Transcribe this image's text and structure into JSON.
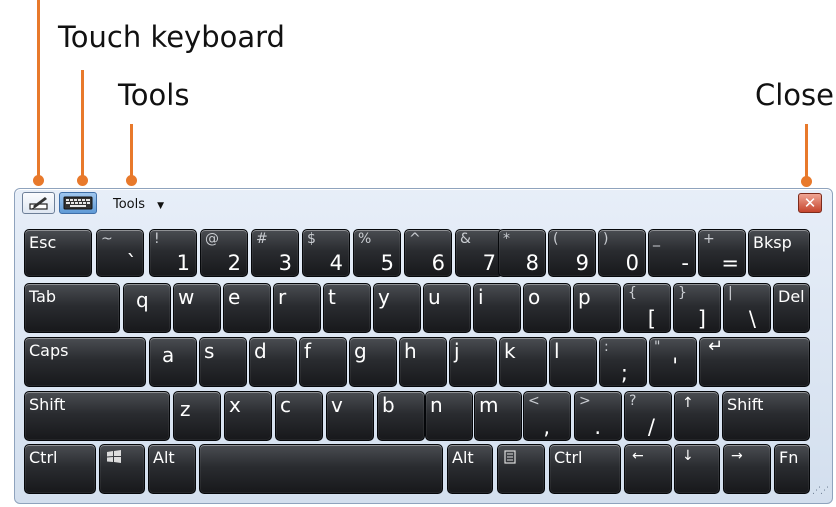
{
  "callouts": {
    "touch_keyboard": "Touch keyboard",
    "tools": "Tools",
    "close": "Close"
  },
  "toolbar": {
    "tools_label": "Tools",
    "tools_arrow": "▼",
    "close_glyph": "✕"
  },
  "colors": {
    "leader": "#e8792b",
    "key": "#1f2023",
    "panel": "#dfe8f3"
  },
  "keys": {
    "esc": "Esc",
    "grave_top": "~",
    "grave_main": "`",
    "k1_top": "!",
    "k1": "1",
    "k2_top": "@",
    "k2": "2",
    "k3_top": "#",
    "k3": "3",
    "k4_top": "$",
    "k4": "4",
    "k5_top": "%",
    "k5": "5",
    "k6_top": "^",
    "k6": "6",
    "k7_top": "&",
    "k7": "7",
    "k8_top": "*",
    "k8": "8",
    "k9_top": "(",
    "k9": "9",
    "k0_top": ")",
    "k0": "0",
    "minus_top": "_",
    "minus": "-",
    "equal_top": "+",
    "equal": "=",
    "bksp": "Bksp",
    "tab": "Tab",
    "q": "q",
    "w": "w",
    "e": "e",
    "r": "r",
    "t": "t",
    "y": "y",
    "u": "u",
    "i": "i",
    "o": "o",
    "p": "p",
    "lbracket_top": "{",
    "lbracket": "[",
    "rbracket_top": "}",
    "rbracket": "]",
    "backslash_top": "|",
    "backslash": "\\",
    "del": "Del",
    "caps": "Caps",
    "a": "a",
    "s": "s",
    "d": "d",
    "f": "f",
    "g": "g",
    "h": "h",
    "j": "j",
    "k": "k",
    "l": "l",
    "semicolon_top": ":",
    "semicolon": ";",
    "quote_top": "\"",
    "quote": "'",
    "enter": "↵",
    "shift": "Shift",
    "z": "z",
    "x": "x",
    "c": "c",
    "v": "v",
    "b": "b",
    "n": "n",
    "m": "m",
    "comma_top": "<",
    "comma": ",",
    "period_top": ">",
    "period": ".",
    "slash_top": "?",
    "slash": "/",
    "up": "↑",
    "shift_r": "Shift",
    "ctrl": "Ctrl",
    "alt": "Alt",
    "alt_r": "Alt",
    "ctrl_r": "Ctrl",
    "left": "←",
    "down": "↓",
    "right": "→",
    "fn": "Fn"
  },
  "icons": {
    "pen": "pen-input-icon",
    "keyboard": "keyboard-icon",
    "windows": "windows-logo-icon",
    "menu": "menu-key-icon"
  }
}
